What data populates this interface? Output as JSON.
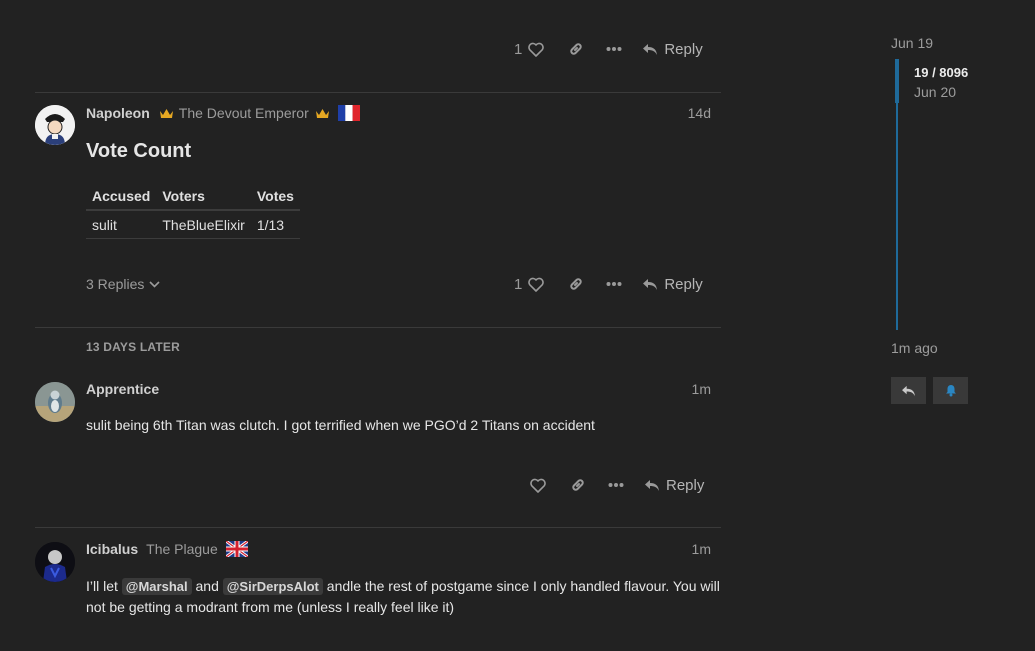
{
  "top_actions": {
    "like_count": "1",
    "reply_label": "Reply"
  },
  "post1": {
    "username": "Napoleon",
    "title": "The Devout Emperor",
    "date": "14d",
    "heading": "Vote Count",
    "table": {
      "headers": [
        "Accused",
        "Voters",
        "Votes"
      ],
      "rows": [
        [
          "sulit",
          "TheBlueElixir",
          "1/13"
        ]
      ]
    },
    "replies_label": "3 Replies",
    "like_count": "1",
    "reply_label": "Reply"
  },
  "time_gap": "13 DAYS LATER",
  "post2": {
    "username": "Apprentice",
    "date": "1m",
    "body": "sulit being 6th Titan was clutch. I got terrified when we PGO’d 2 Titans on accident",
    "reply_label": "Reply"
  },
  "post3": {
    "username": "Icibalus",
    "title": "The Plague",
    "date": "1m",
    "body_part1": "I’ll let",
    "mention1": "@Marshal",
    "body_part2": "and",
    "mention2": "@SirDerpsAlot",
    "body_part3": "andle the rest of postgame since I only handled flavour. You will",
    "body_line2": "not be getting a modrant from me (unless I really feel like it)"
  },
  "timeline": {
    "start_date": "Jun 19",
    "position": "19 / 8096",
    "current_date": "Jun 20",
    "end_label": "1m ago"
  },
  "colors": {
    "accent": "#1f6a9a",
    "background": "#222222",
    "text": "#dddddd"
  }
}
